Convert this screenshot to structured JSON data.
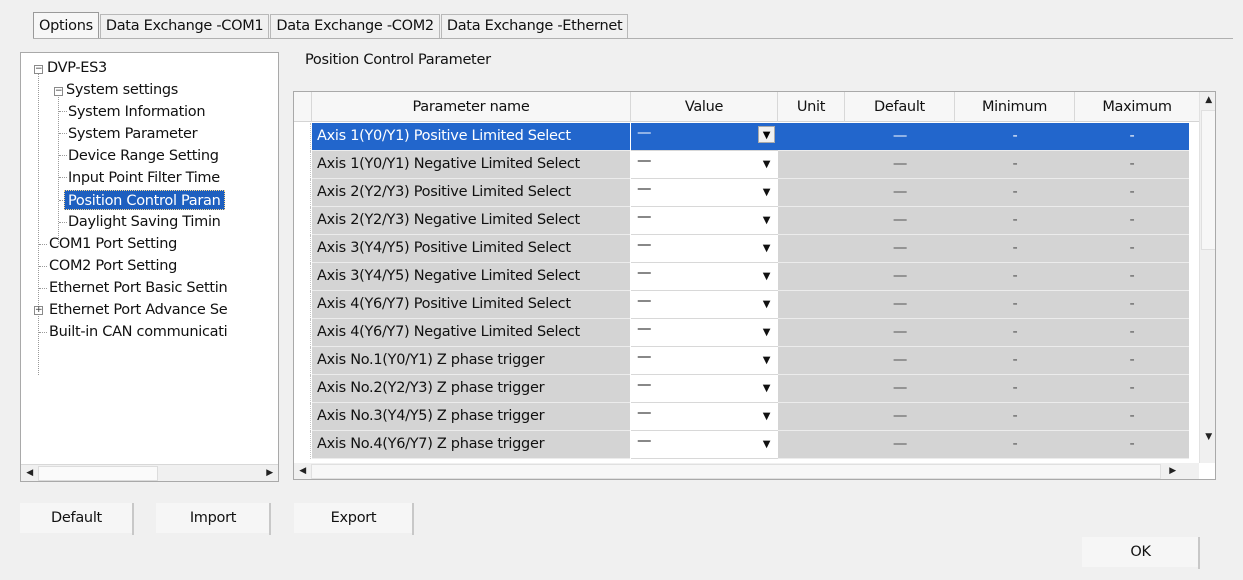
{
  "tabs": [
    "Options",
    "Data Exchange -COM1",
    "Data Exchange -COM2",
    "Data Exchange -Ethernet"
  ],
  "tree": {
    "root": "DVP-ES3",
    "system_settings": "System settings",
    "system_children": [
      "System Information",
      "System Parameter",
      "Device Range Setting",
      "Input Point Filter Time",
      "Position Control Paran",
      "Daylight Saving Timin"
    ],
    "root_children": [
      "COM1 Port Setting",
      "COM2 Port Setting",
      "Ethernet Port Basic Settin",
      "Ethernet Port Advance Se",
      "Built-in CAN communicati"
    ],
    "selected": "Position Control Paran"
  },
  "grid": {
    "title": "Position Control Parameter",
    "columns": [
      "Parameter name",
      "Value",
      "Unit",
      "Default",
      "Minimum",
      "Maximum"
    ],
    "rows": [
      {
        "name": "Axis 1(Y0/Y1) Positive Limited Select",
        "value": "—",
        "unit": "",
        "default": "—",
        "minimum": "-",
        "maximum": "-"
      },
      {
        "name": "Axis 1(Y0/Y1) Negative Limited Select",
        "value": "—",
        "unit": "",
        "default": "—",
        "minimum": "-",
        "maximum": "-"
      },
      {
        "name": "Axis 2(Y2/Y3) Positive Limited Select",
        "value": "—",
        "unit": "",
        "default": "—",
        "minimum": "-",
        "maximum": "-"
      },
      {
        "name": "Axis 2(Y2/Y3) Negative Limited Select",
        "value": "—",
        "unit": "",
        "default": "—",
        "minimum": "-",
        "maximum": "-"
      },
      {
        "name": "Axis 3(Y4/Y5) Positive Limited Select",
        "value": "—",
        "unit": "",
        "default": "—",
        "minimum": "-",
        "maximum": "-"
      },
      {
        "name": "Axis 3(Y4/Y5) Negative Limited Select",
        "value": "—",
        "unit": "",
        "default": "—",
        "minimum": "-",
        "maximum": "-"
      },
      {
        "name": "Axis 4(Y6/Y7) Positive Limited Select",
        "value": "—",
        "unit": "",
        "default": "—",
        "minimum": "-",
        "maximum": "-"
      },
      {
        "name": "Axis 4(Y6/Y7) Negative Limited Select",
        "value": "—",
        "unit": "",
        "default": "—",
        "minimum": "-",
        "maximum": "-"
      },
      {
        "name": "Axis No.1(Y0/Y1) Z phase trigger",
        "value": "—",
        "unit": "",
        "default": "—",
        "minimum": "-",
        "maximum": "-"
      },
      {
        "name": "Axis No.2(Y2/Y3) Z phase trigger",
        "value": "—",
        "unit": "",
        "default": "—",
        "minimum": "-",
        "maximum": "-"
      },
      {
        "name": "Axis No.3(Y4/Y5) Z phase trigger",
        "value": "—",
        "unit": "",
        "default": "—",
        "minimum": "-",
        "maximum": "-"
      },
      {
        "name": "Axis No.4(Y6/Y7) Z phase trigger",
        "value": "—",
        "unit": "",
        "default": "—",
        "minimum": "-",
        "maximum": "-"
      }
    ],
    "selected_row": 0
  },
  "buttons": {
    "default": "Default",
    "import": "Import",
    "export": "Export",
    "ok": "OK"
  },
  "icons": {
    "expanded": "minus-box-icon",
    "collapsed": "plus-box-icon",
    "dropdown": "chevron-down-icon",
    "scroll_left": "triangle-left-icon",
    "scroll_right": "triangle-right-icon",
    "scroll_up": "triangle-up-icon",
    "scroll_down": "triangle-down-icon"
  },
  "colors": {
    "selection": "#2266cc",
    "readonly_cell": "#d4d4d4"
  }
}
